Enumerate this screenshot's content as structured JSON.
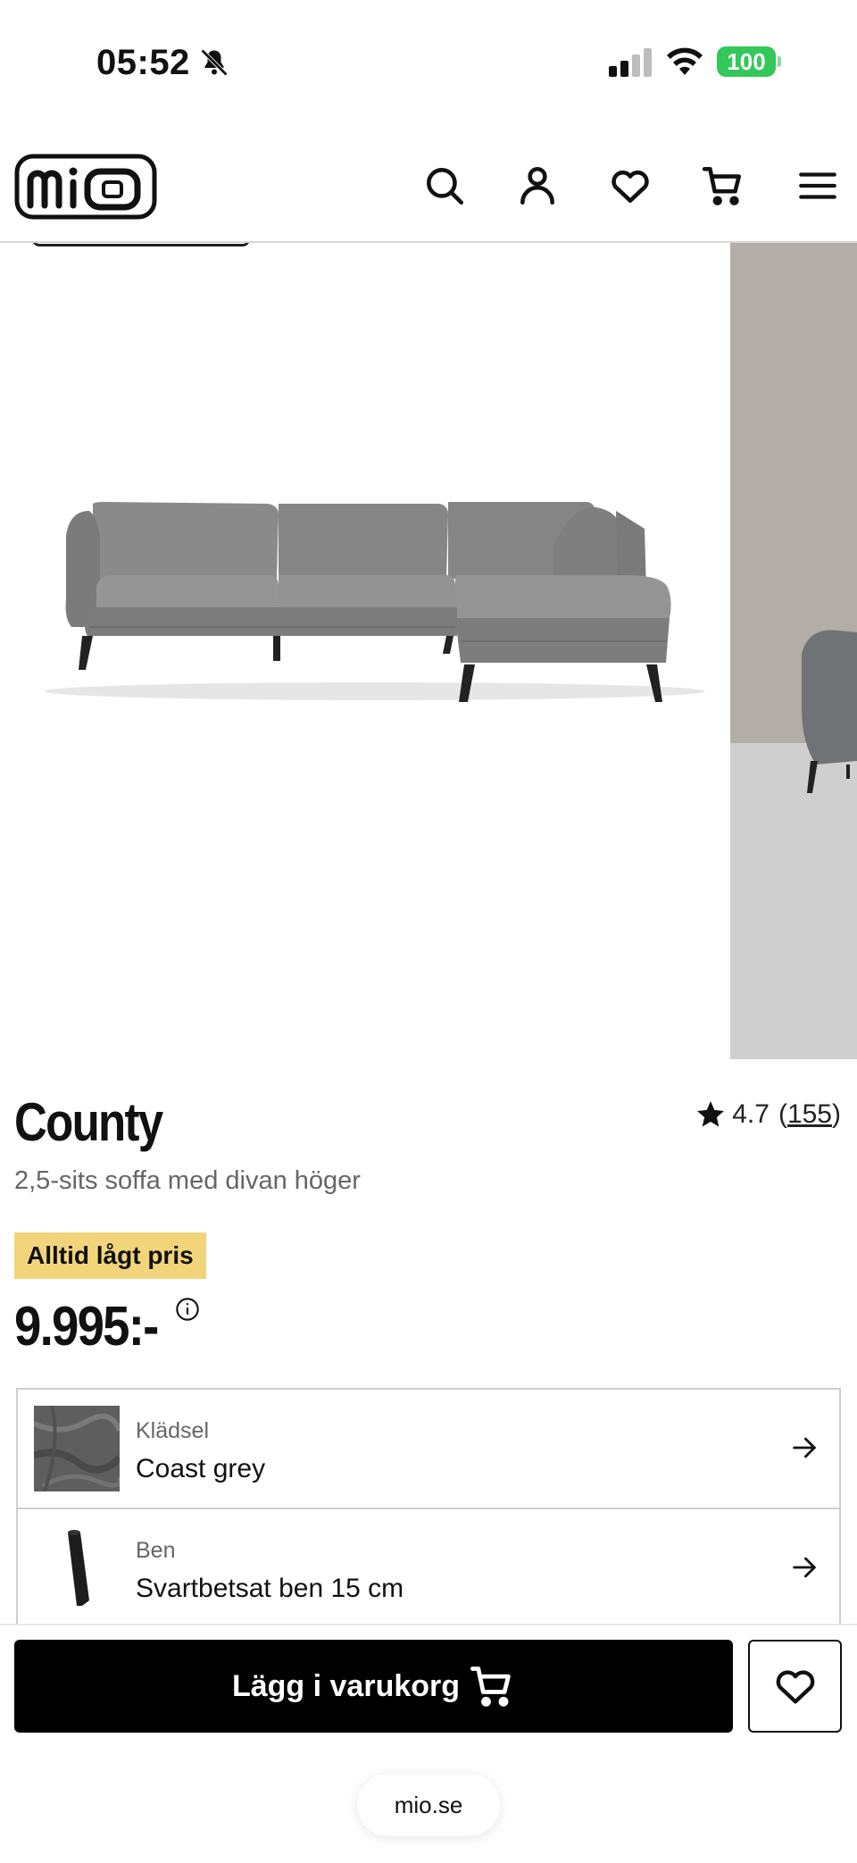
{
  "status_bar": {
    "time": "05:52",
    "battery": "100",
    "icons": [
      "bell-slash-icon",
      "signal-icon",
      "wifi-icon",
      "battery-icon"
    ]
  },
  "header": {
    "logo_text": "mio",
    "icons": [
      "search-icon",
      "account-icon",
      "heart-icon",
      "cart-icon",
      "menu-icon"
    ]
  },
  "product": {
    "title": "County",
    "subtitle": "2,5-sits soffa med divan höger",
    "rating": "4.7",
    "review_count": "155",
    "price_badge": "Alltid lågt pris",
    "price": "9.995:-"
  },
  "options": [
    {
      "label": "Klädsel",
      "value": "Coast grey",
      "thumb": "fabric-swatch"
    },
    {
      "label": "Ben",
      "value": "Svartbetsat ben 15 cm",
      "thumb": "leg-image"
    }
  ],
  "actions": {
    "add_to_cart": "Lägg i varukorg"
  },
  "browser": {
    "url": "mio.se"
  },
  "colors": {
    "accent_badge": "#f2d57a",
    "button": "#000000",
    "battery": "#34c759"
  }
}
